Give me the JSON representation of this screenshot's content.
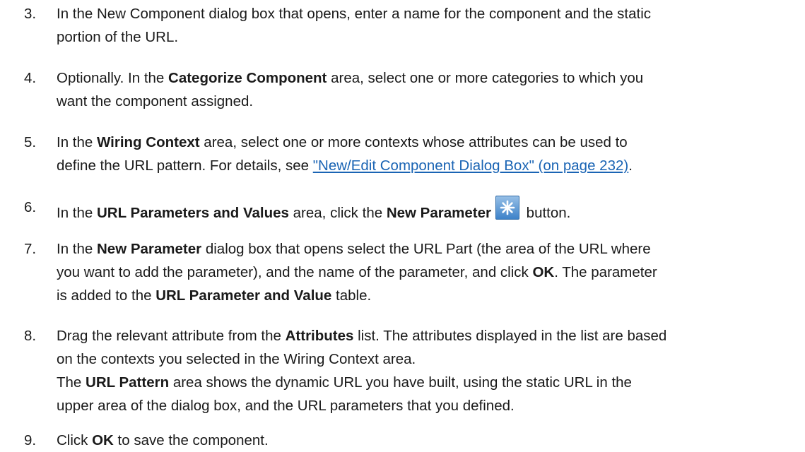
{
  "steps": [
    {
      "number": "3.",
      "line1": "In the New Component dialog box that opens, enter a name for the component and the static",
      "line2": "portion of the URL."
    },
    {
      "number": "4.",
      "t1": "Optionally. In the ",
      "b1": "Categorize Component",
      "t2": " area, select one or more categories to which you",
      "line2": "want the component assigned."
    },
    {
      "number": "5.",
      "t1": "In the ",
      "b1": "Wiring Context",
      "t2": " area, select one or more contexts whose attributes can be used to",
      "t3": "define the URL pattern. For details, see ",
      "link": "\"New/Edit Component Dialog Box\" (on page 232)",
      "t4": "."
    },
    {
      "number": "6.",
      "t1": "In the ",
      "b1": "URL Parameters and Values",
      "t2": " area, click the ",
      "b2": "New Parameter",
      "icon": "new-parameter-asterisk-icon",
      "t3": " button."
    },
    {
      "number": "7.",
      "t1": "In the ",
      "b1": "New Parameter",
      "t2": " dialog box that opens select the URL Part (the area of the URL where",
      "t3": "you want to add the parameter), and the name of the parameter, and click ",
      "b2": "OK",
      "t4": ". The parameter",
      "t5": "is added to the ",
      "b3": "URL Parameter and Value",
      "t6": " table."
    },
    {
      "number": "8.",
      "t1": "Drag the relevant attribute from the ",
      "b1": "Attributes",
      "t2": " list. The attributes displayed in the list are based",
      "t3": "on the contexts you selected in the Wiring Context area.",
      "t4": "The ",
      "b2": "URL Pattern",
      "t5": " area shows the dynamic URL you have built, using the static URL in the",
      "t6": "upper area of the dialog box, and the URL parameters that you defined."
    },
    {
      "number": "9.",
      "t1": "Click ",
      "b1": "OK",
      "t2": " to save the component."
    }
  ],
  "colors": {
    "text": "#1a1a1a",
    "link": "#1a64b4",
    "icon": "#3d82c9"
  }
}
